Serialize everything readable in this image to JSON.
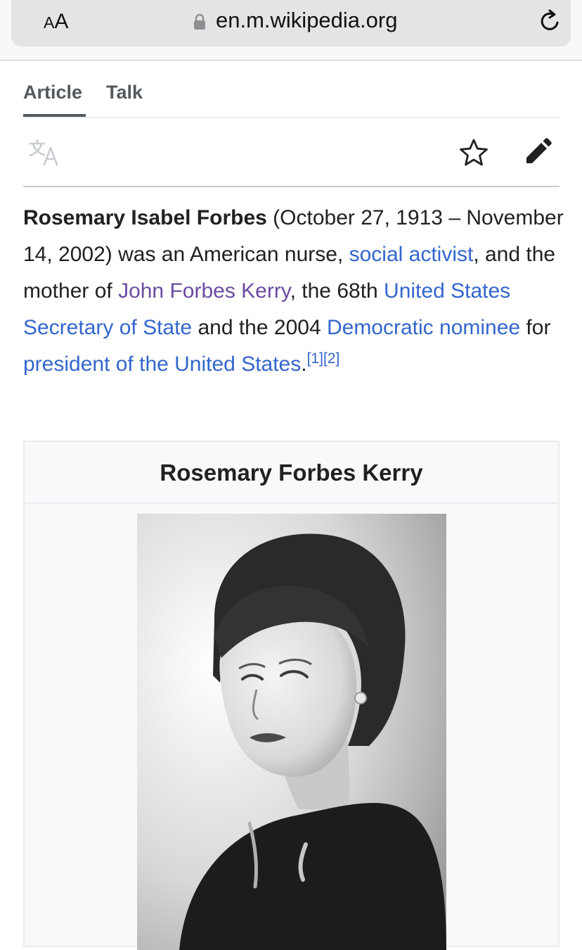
{
  "browser": {
    "aa_small": "A",
    "aa_large": "A",
    "url": "en.m.wikipedia.org",
    "icons": [
      "lock-icon",
      "reload-icon"
    ]
  },
  "tabs": [
    {
      "label": "Article",
      "active": true
    },
    {
      "label": "Talk",
      "active": false
    }
  ],
  "toolbar": {
    "icons": [
      "translate-icon",
      "star-icon",
      "edit-icon"
    ]
  },
  "lead": {
    "subject": "Rosemary Isabel Forbes",
    "t1": " (October 27, 1913 – November 14, 2002) was an American nurse, ",
    "l1": "social activist",
    "t2": ", and the mother of ",
    "l2": "John Forbes Kerry",
    "t3": ", the 68th ",
    "l3": "United States Secretary of State",
    "t4": " and the 2004 ",
    "l4": "Democratic nominee",
    "t5": " for ",
    "l5": "president of the United States",
    "t6": ".",
    "ref1": "[1]",
    "ref2": "[2]"
  },
  "infobox": {
    "title": "Rosemary Forbes Kerry"
  },
  "colors": {
    "link": "#3366cc",
    "visited_link": "#6b4ba1",
    "text": "#202122"
  }
}
